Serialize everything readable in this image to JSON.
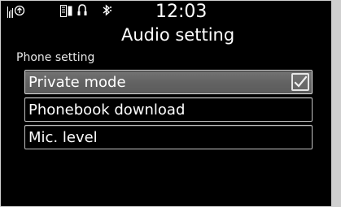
{
  "status_bar": {
    "time": "12:03",
    "icons": [
      "signal-icon",
      "phone-icon",
      "phonebook-icon",
      "headset-icon",
      "bluetooth-icon"
    ]
  },
  "header": {
    "title": "Audio setting"
  },
  "section": {
    "label": "Phone setting"
  },
  "menu": {
    "items": [
      {
        "label": "Private mode",
        "checked": true,
        "selected": true
      },
      {
        "label": "Phonebook download",
        "selected": false
      },
      {
        "label": "Mic. level",
        "selected": false
      }
    ]
  },
  "colors": {
    "background": "#000000",
    "text": "#ffffff",
    "selected_bar": "#6a6a6a",
    "border": "#b7b7b7"
  }
}
